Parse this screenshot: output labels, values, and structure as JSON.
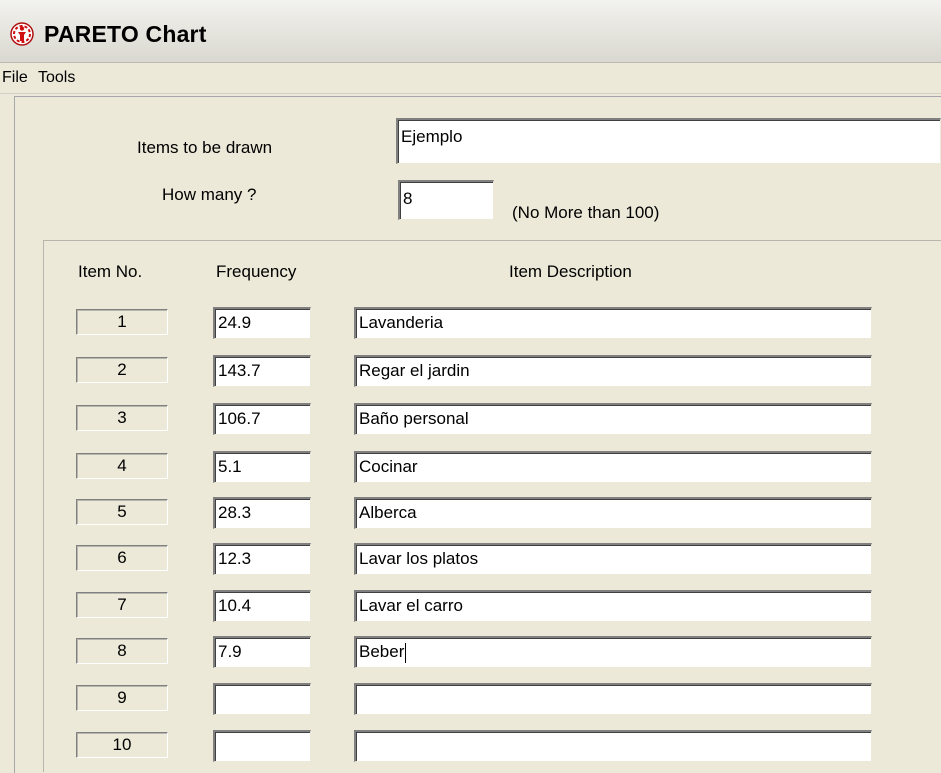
{
  "window": {
    "title": "PARETO Chart",
    "icon": "pareto-app-icon"
  },
  "menu": {
    "file": "File",
    "tools": "Tools"
  },
  "form": {
    "items_label": "Items to be drawn",
    "items_value": "Ejemplo",
    "how_many_label": "How many ?",
    "how_many_value": "8",
    "how_many_hint": "(No More than 100)"
  },
  "table": {
    "headers": {
      "item_no": "Item No.",
      "frequency": "Frequency",
      "description": "Item Description"
    },
    "rows": [
      {
        "no": "1",
        "frequency": "24.9",
        "description": "Lavanderia"
      },
      {
        "no": "2",
        "frequency": "143.7",
        "description": "Regar el jardin"
      },
      {
        "no": "3",
        "frequency": "106.7",
        "description": "Baño personal"
      },
      {
        "no": "4",
        "frequency": "5.1",
        "description": "Cocinar"
      },
      {
        "no": "5",
        "frequency": "28.3",
        "description": "Alberca"
      },
      {
        "no": "6",
        "frequency": "12.3",
        "description": "Lavar los platos"
      },
      {
        "no": "7",
        "frequency": "10.4",
        "description": "Lavar el carro"
      },
      {
        "no": "8",
        "frequency": "7.9",
        "description": "Beber"
      },
      {
        "no": "9",
        "frequency": "",
        "description": ""
      },
      {
        "no": "10",
        "frequency": "",
        "description": ""
      }
    ]
  },
  "colors": {
    "window_bg": "#ece9d8",
    "field_bg": "#ffffff",
    "icon_red": "#d01010"
  }
}
